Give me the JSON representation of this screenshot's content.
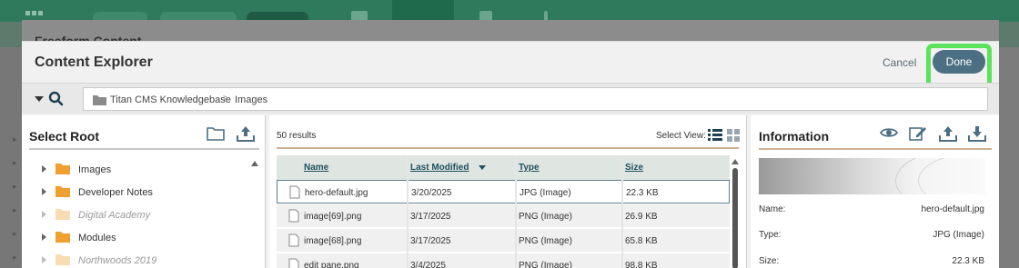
{
  "background": {
    "title": "Freeform Content",
    "cancel": "Cancel",
    "done": "Done"
  },
  "modal": {
    "title": "Content Explorer",
    "cancel_label": "Cancel",
    "done_label": "Done"
  },
  "breadcrumb": {
    "root": "Titan CMS Knowledgebase",
    "separator": ">",
    "current": "Images"
  },
  "left_pane": {
    "title": "Select Root",
    "items": [
      {
        "label": "Images",
        "muted": false
      },
      {
        "label": "Developer Notes",
        "muted": false
      },
      {
        "label": "Digital Academy",
        "muted": true
      },
      {
        "label": "Modules",
        "muted": false
      },
      {
        "label": "Northwoods 2019",
        "muted": true
      }
    ]
  },
  "middle_pane": {
    "results": "50 results",
    "select_view": "Select View:",
    "columns": {
      "name": "Name",
      "modified": "Last Modified",
      "type": "Type",
      "size": "Size"
    },
    "rows": [
      {
        "name": "hero-default.jpg",
        "modified": "3/20/2025",
        "type": "JPG (Image)",
        "size": "22.3 KB",
        "selected": true
      },
      {
        "name": "image[69].png",
        "modified": "3/17/2025",
        "type": "PNG (Image)",
        "size": "26.9 KB",
        "selected": false
      },
      {
        "name": "image[68].png",
        "modified": "3/17/2025",
        "type": "PNG (Image)",
        "size": "65.8 KB",
        "selected": false
      },
      {
        "name": "edit pane.png",
        "modified": "3/4/2025",
        "type": "PNG (Image)",
        "size": "98.8 KB",
        "selected": false
      }
    ]
  },
  "right_pane": {
    "title": "Information",
    "fields": [
      {
        "key": "Name:",
        "value": "hero-default.jpg"
      },
      {
        "key": "Type:",
        "value": "JPG (Image)"
      },
      {
        "key": "Size:",
        "value": "22.3 KB"
      }
    ]
  },
  "colors": {
    "app_green": "#2f7a5c",
    "done_button": "#4d6f83",
    "highlight": "#5be35b",
    "folder": "#f0a030"
  }
}
